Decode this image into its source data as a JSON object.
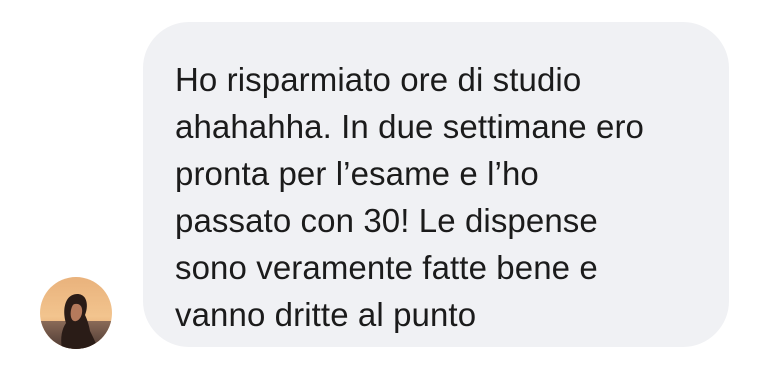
{
  "conversation": {
    "message": {
      "text": "Ho risparmiato ore di studio\nahahahha. In due settimane ero\npronta per l’esame e l’ho\npassato con 30! Le dispense\nsono veramente fatte bene e\nvanno dritte al punto"
    },
    "sender": {
      "avatar_icon": "profile-photo-icon"
    }
  },
  "colors": {
    "bubble_background": "#f0f1f4",
    "text": "#1b1b1b",
    "page_background": "#ffffff"
  }
}
